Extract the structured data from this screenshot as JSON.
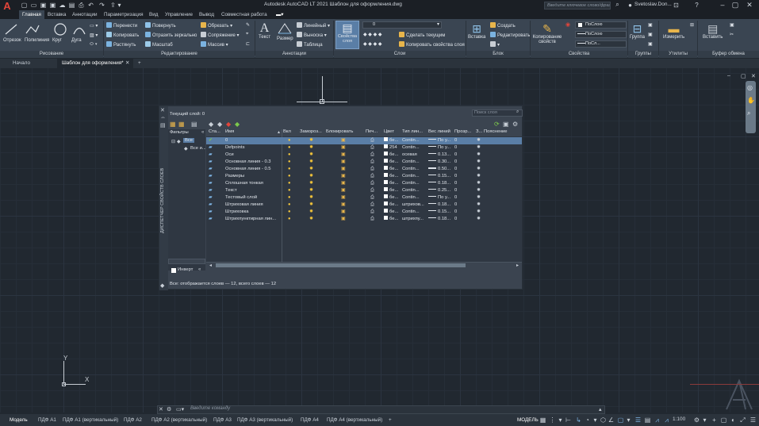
{
  "app": {
    "title": "Autodesk AutoCAD LT 2021  Шаблон для оформления.dwg",
    "search_placeholder": "Введите ключевое слово/фразу",
    "user": "Svetoslav.Don...",
    "logo": "A"
  },
  "ribbon_tabs": [
    "Главная",
    "Вставка",
    "Аннотации",
    "Параметризация",
    "Вид",
    "Управление",
    "Вывод",
    "Совместная работа"
  ],
  "ribbon": {
    "draw": {
      "title": "Рисование",
      "items": [
        "Отрезок",
        "Полилиния",
        "Круг",
        "Дуга"
      ]
    },
    "modify": {
      "title": "Редактирование",
      "items": [
        "Перенести",
        "Повернуть",
        "Обрезать",
        "Копировать",
        "Отразить зеркально",
        "Сопряжение",
        "Растянуть",
        "Масштаб",
        "Массив"
      ]
    },
    "annotation": {
      "title": "Аннотации",
      "items": [
        "Текст",
        "Размер",
        "Линейный",
        "Выноска",
        "Таблица"
      ]
    },
    "layers": {
      "title": "Слои",
      "big": "Свойства слоя",
      "current": "0",
      "items": [
        "Сделать текущим",
        "Копировать свойства слоя"
      ]
    },
    "block": {
      "title": "Блок",
      "big": "Вставка",
      "items": [
        "Создать",
        "Редактировать"
      ]
    },
    "properties": {
      "title": "Свойства",
      "big": "Копирование свойств",
      "values": [
        "ПоСлою",
        "ПоСлою",
        "ПоСл..."
      ]
    },
    "groups": {
      "title": "Группы",
      "big": "Группа"
    },
    "utilities": {
      "title": "Утилиты",
      "big": "Измерить"
    },
    "clipboard": {
      "title": "Буфер обмена",
      "big": "Вставить"
    }
  },
  "doc_tabs": [
    "Начало",
    "Шаблон для оформления*"
  ],
  "layer_palette": {
    "current_layer": "Текущий слой: 0",
    "search_placeholder": "Поиск слоя",
    "filters_header": "Фильтры",
    "filter_tree": [
      "Все",
      "Все и..."
    ],
    "invert_label": "Инверт",
    "status_text": "Все: отображается слоев — 12, всего слоев — 12",
    "side_title": "ДИСПЕТЧЕР СВОЙСТВ СЛОЕВ",
    "columns": [
      "Ста...",
      "Имя",
      "Вкл",
      "Замороз...",
      "Блокировать",
      "Печ...",
      "Цвет",
      "Тип лин...",
      "Вес линий",
      "Прозр...",
      "З...",
      "Пояснение"
    ],
    "rows": [
      {
        "name": "0",
        "color": "бе...",
        "linetype": "Contin...",
        "lineweight": "По у...",
        "transp": "0",
        "current": true
      },
      {
        "name": "Defpoints",
        "color": "254",
        "linetype": "Contin...",
        "lineweight": "По у...",
        "transp": "0"
      },
      {
        "name": "Оси",
        "color": "бе...",
        "linetype": "осевая",
        "lineweight": "0.13...",
        "transp": "0"
      },
      {
        "name": "Основная линия - 0.3",
        "color": "бе...",
        "linetype": "Contin...",
        "lineweight": "0.30...",
        "transp": "0"
      },
      {
        "name": "Основная линия - 0.5",
        "color": "бе...",
        "linetype": "Contin...",
        "lineweight": "0.50...",
        "transp": "0",
        "thick": true
      },
      {
        "name": "Размеры",
        "color": "бе...",
        "linetype": "Contin...",
        "lineweight": "0.15...",
        "transp": "0"
      },
      {
        "name": "Сплошная тонкая",
        "color": "бе...",
        "linetype": "Contin...",
        "lineweight": "0.18...",
        "transp": "0"
      },
      {
        "name": "Текст",
        "color": "бе...",
        "linetype": "Contin...",
        "lineweight": "0.25...",
        "transp": "0"
      },
      {
        "name": "Тестовый слой",
        "color": "бе...",
        "linetype": "Contin...",
        "lineweight": "По у...",
        "transp": "0"
      },
      {
        "name": "Штриховая линия",
        "color": "бе...",
        "linetype": "штрихов...",
        "lineweight": "0.18...",
        "transp": "0"
      },
      {
        "name": "Штриховка",
        "color": "бе...",
        "linetype": "Contin...",
        "lineweight": "0.15...",
        "transp": "0"
      },
      {
        "name": "Штрихпунктирная лин...",
        "color": "бе...",
        "linetype": "штрихпу...",
        "lineweight": "0.18...",
        "transp": "0"
      }
    ]
  },
  "command": {
    "placeholder": "Введите команду"
  },
  "layout_tabs": [
    "Модель",
    "ПДФ А1",
    "ПДФ А1 (вертикальный)",
    "ПДФ А2",
    "ПДФ А2 (вертикальный)",
    "ПДФ А3",
    "ПДФ А3 (вертикальный)",
    "ПДФ А4",
    "ПДФ А4 (вертикальный)"
  ],
  "status": {
    "model": "МОДЕЛЬ",
    "scale": "1:100"
  },
  "ucs": {
    "x": "X",
    "y": "Y"
  }
}
